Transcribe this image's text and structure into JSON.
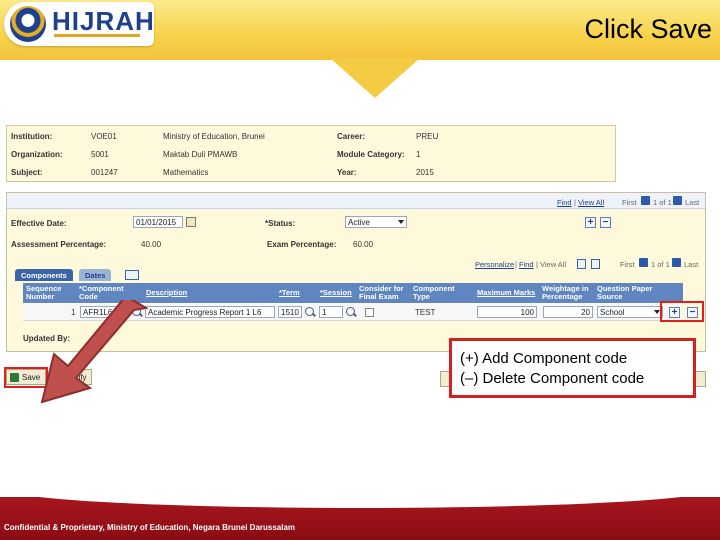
{
  "header": {
    "logo_text": "HIJRAH",
    "slide_title": "Click Save"
  },
  "info": {
    "institution_label": "Institution:",
    "institution_code": "VOE01",
    "institution_name": "Ministry of Education, Brunei",
    "organization_label": "Organization:",
    "organization_code": "5001",
    "organization_name": "Maktab Duli PMAWB",
    "subject_label": "Subject:",
    "subject_code": "001247",
    "subject_name": "Mathematics",
    "career_label": "Career:",
    "career_value": "PREU",
    "module_category_label": "Module Category:",
    "module_category_value": "1",
    "year_label": "Year:",
    "year_value": "2015"
  },
  "panel": {
    "nav_find": "Find",
    "nav_view_all": "View All",
    "nav_first": "First",
    "nav_range": "1 of 1",
    "nav_last": "Last",
    "effective_date_label": "Effective Date:",
    "effective_date_value": "01/01/2015",
    "status_label": "*Status:",
    "status_value": "Active",
    "assessment_pct_label": "Assessment Percentage:",
    "assessment_pct_value": "40.00",
    "exam_pct_label": "Exam Percentage:",
    "exam_pct_value": "60.00",
    "tabs": [
      {
        "label": "Components",
        "active": true
      },
      {
        "label": "Dates",
        "active": false
      }
    ],
    "grid_nav": {
      "personalize": "Personalize",
      "find": "Find",
      "view_all": "View All",
      "first": "First",
      "range": "1 of 1",
      "last": "Last"
    },
    "columns": [
      "Sequence Number",
      "*Component Code",
      "Description",
      "*Term",
      "*Session",
      "Consider for Final Exam",
      "Component Type",
      "Maximum Marks",
      "Weightage in Percentage",
      "Question Paper Source"
    ],
    "row": {
      "sequence": "1",
      "component_code": "AFR1L6",
      "description": "Academic Progress Report 1 L6",
      "term": "1510",
      "session": "1",
      "component_type": "TEST",
      "maximum_marks": "100",
      "weightage": "20",
      "question_paper_source": "School"
    },
    "updated_by_label": "Updated By:"
  },
  "toolbar": {
    "save_label": "Save",
    "notify_label": "Notify"
  },
  "callout": {
    "add_line": "(+) Add Component code",
    "delete_line": "(–) Delete Component code"
  },
  "footer": {
    "text": "Confidential & Proprietary, Ministry of Education, Negara Brunei Darussalam"
  },
  "colors": {
    "banner_yellow": "#f7d34a",
    "highlight_red": "#e02020",
    "grid_header_blue": "#5f86c1",
    "footer_red": "#a8161e",
    "arrow_red": "#c0504d"
  }
}
